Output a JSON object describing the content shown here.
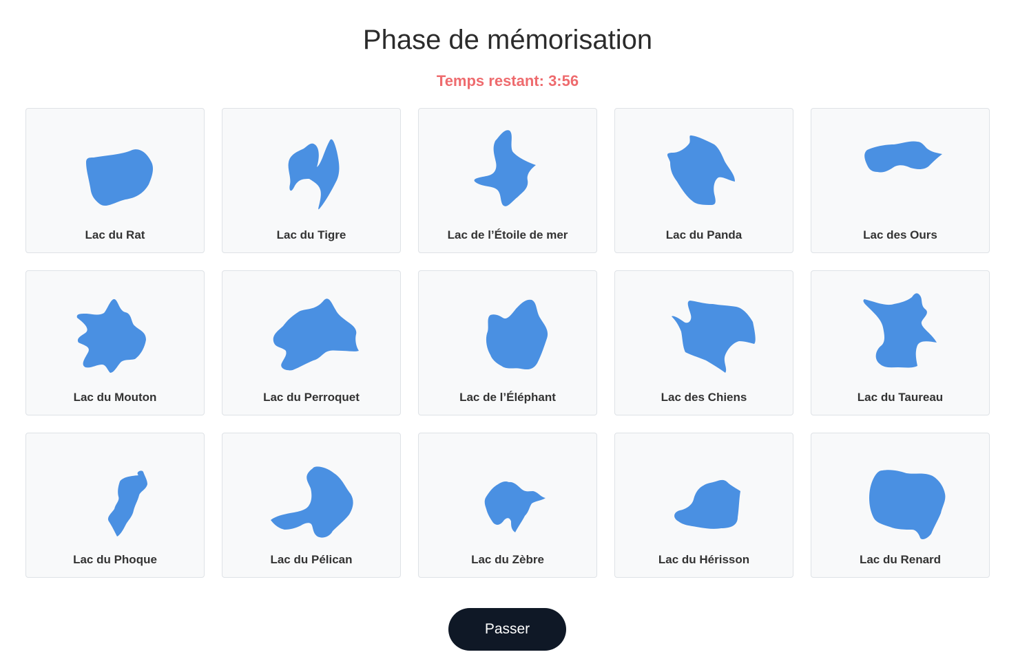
{
  "page_title": "Phase de mémorisation",
  "timer": {
    "label": "Temps restant: 3:56"
  },
  "colors": {
    "lake_fill": "#4a90e2",
    "timer": "#ee6b6e",
    "button_bg": "#0f1826",
    "button_text": "#ffffff"
  },
  "lakes": [
    {
      "name": "Lac du Rat",
      "icon": "lake-shape-icon"
    },
    {
      "name": "Lac du Tigre",
      "icon": "lake-shape-icon"
    },
    {
      "name": "Lac de l’Étoile de mer",
      "icon": "lake-shape-icon"
    },
    {
      "name": "Lac du Panda",
      "icon": "lake-shape-icon"
    },
    {
      "name": "Lac des Ours",
      "icon": "lake-shape-icon"
    },
    {
      "name": "Lac du Mouton",
      "icon": "lake-shape-icon"
    },
    {
      "name": "Lac du Perroquet",
      "icon": "lake-shape-icon"
    },
    {
      "name": "Lac de l’Éléphant",
      "icon": "lake-shape-icon"
    },
    {
      "name": "Lac des Chiens",
      "icon": "lake-shape-icon"
    },
    {
      "name": "Lac du Taureau",
      "icon": "lake-shape-icon"
    },
    {
      "name": "Lac du Phoque",
      "icon": "lake-shape-icon"
    },
    {
      "name": "Lac du Pélican",
      "icon": "lake-shape-icon"
    },
    {
      "name": "Lac du Zèbre",
      "icon": "lake-shape-icon"
    },
    {
      "name": "Lac du Hérisson",
      "icon": "lake-shape-icon"
    },
    {
      "name": "Lac du Renard",
      "icon": "lake-shape-icon"
    }
  ],
  "skip_button": {
    "label": "Passer"
  }
}
